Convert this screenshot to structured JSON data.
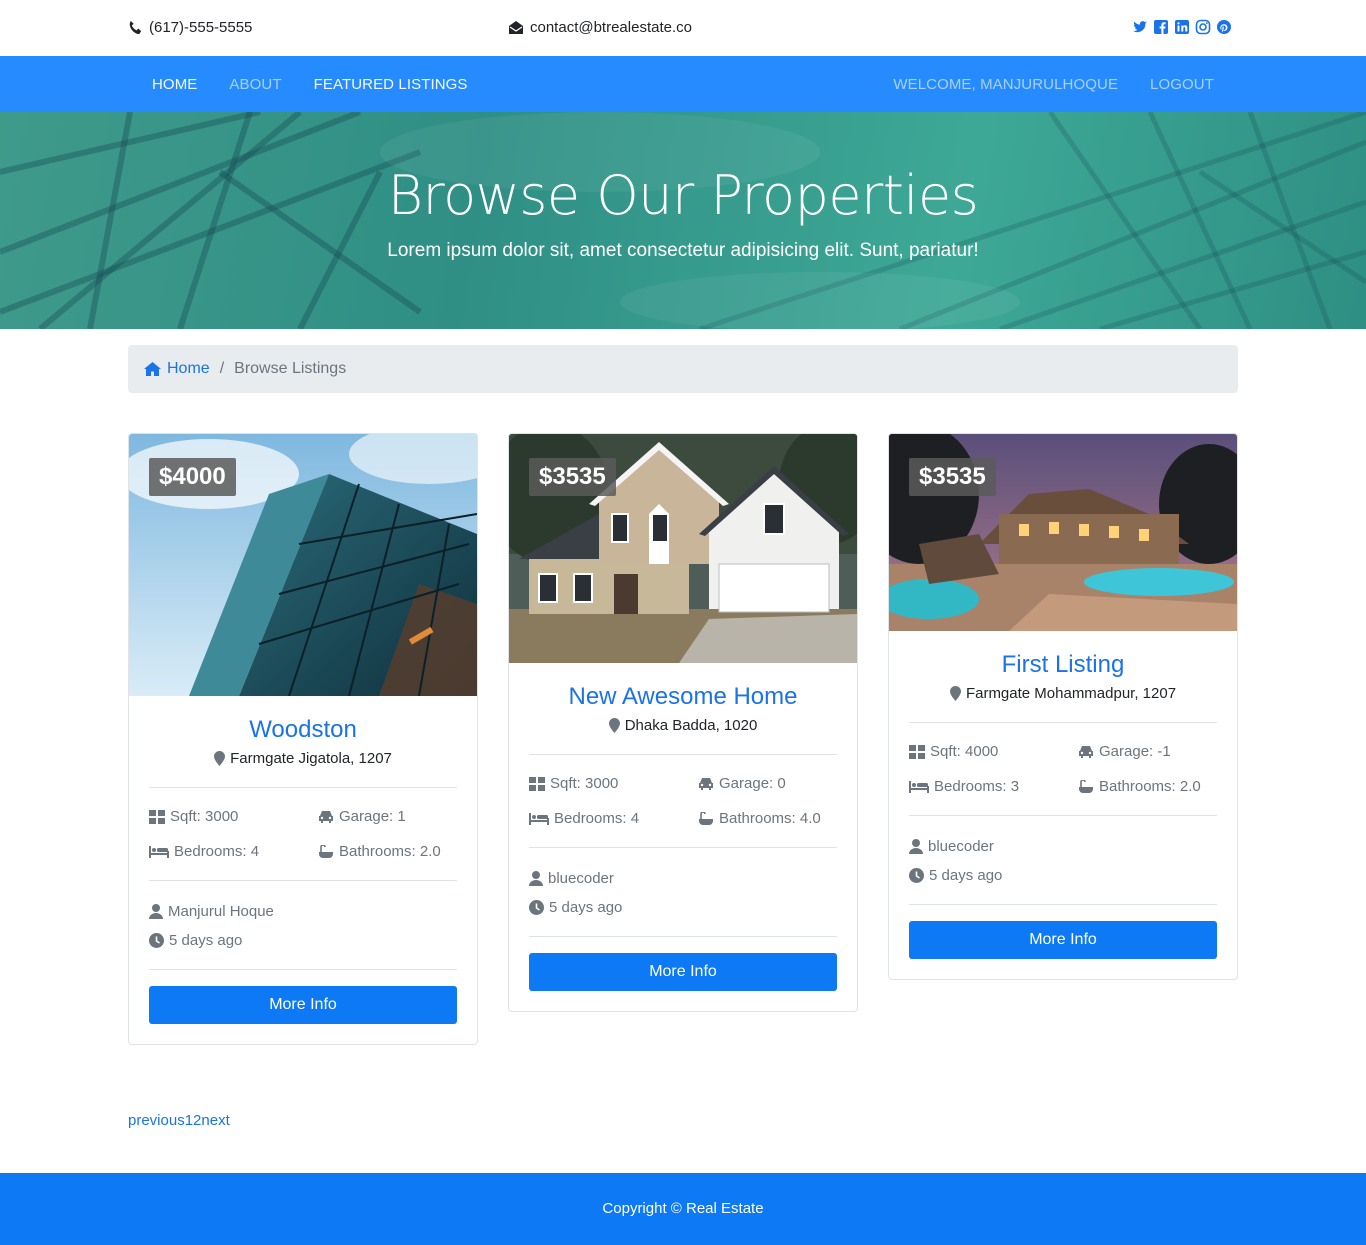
{
  "topbar": {
    "phone": "(617)-555-5555",
    "email": "contact@btrealestate.co",
    "social": [
      "twitter-icon",
      "facebook-icon",
      "linkedin-icon",
      "instagram-icon",
      "pinterest-icon"
    ]
  },
  "nav": {
    "left": [
      "Home",
      "About",
      "Featured Listings"
    ],
    "right": [
      "Welcome, manjurulhoque",
      "Logout"
    ]
  },
  "hero": {
    "title": "Browse Our Properties",
    "subtitle": "Lorem ipsum dolor sit, amet consectetur adipisicing elit. Sunt, pariatur!"
  },
  "breadcrumb": {
    "home": "Home",
    "current": "Browse Listings"
  },
  "listings": [
    {
      "price": "$4000",
      "title": "Woodston",
      "location": "Farmgate Jigatola, 1207",
      "sqft": "Sqft: 3000",
      "garage": "Garage: 1",
      "bedrooms": "Bedrooms: 4",
      "bathrooms": "Bathrooms: 2.0",
      "realtor": "Manjurul Hoque",
      "posted": "5 days ago",
      "button": "More Info"
    },
    {
      "price": "$3535",
      "title": "New Awesome Home",
      "location": "Dhaka Badda, 1020",
      "sqft": "Sqft: 3000",
      "garage": "Garage: 0",
      "bedrooms": "Bedrooms: 4",
      "bathrooms": "Bathrooms: 4.0",
      "realtor": "bluecoder",
      "posted": "5 days ago",
      "button": "More Info"
    },
    {
      "price": "$3535",
      "title": "First Listing",
      "location": "Farmgate Mohammadpur, 1207",
      "sqft": "Sqft: 4000",
      "garage": "Garage: -1",
      "bedrooms": "Bedrooms: 3",
      "bathrooms": "Bathrooms: 2.0",
      "realtor": "bluecoder",
      "posted": "5 days ago",
      "button": "More Info"
    }
  ],
  "pagination": {
    "previous": "previous",
    "pages": [
      "1",
      "2"
    ],
    "next": "next"
  },
  "footer": {
    "copyright": "Copyright © Real Estate"
  },
  "colors": {
    "nav_bg": "#268bff",
    "primary": "#0d79f5",
    "link": "#1a73e8",
    "breadcrumb_bg": "#e9ecef"
  }
}
